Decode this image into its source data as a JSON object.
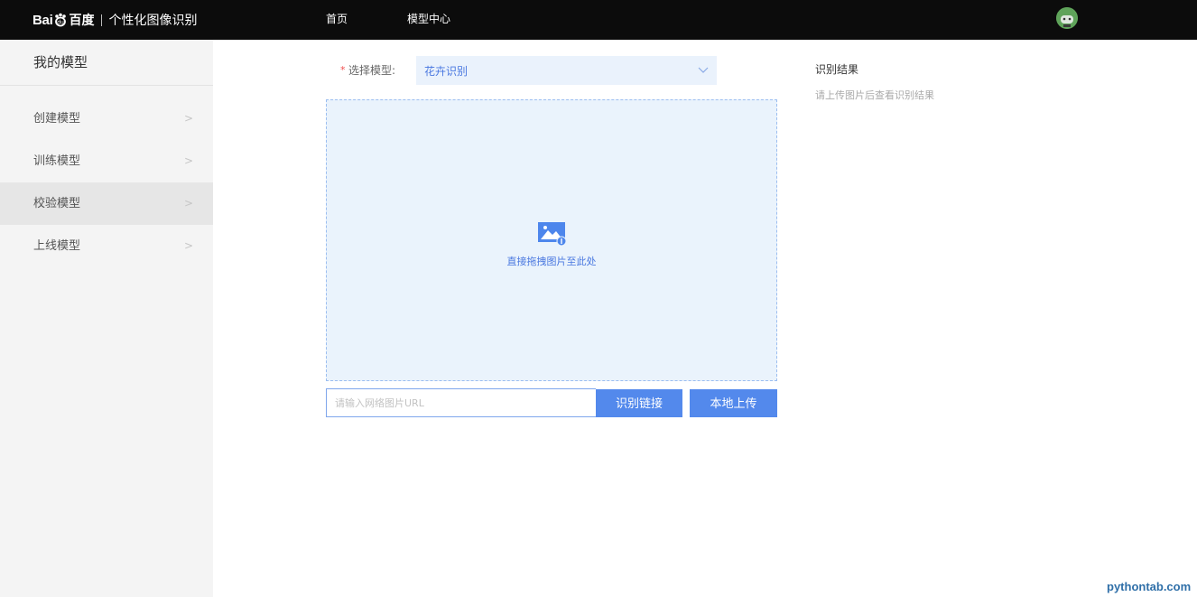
{
  "header": {
    "logo_bai": "Bai",
    "logo_du": "百度",
    "product_name": "个性化图像识别",
    "nav": [
      "首页",
      "模型中心"
    ],
    "avatar_icon": "user-avatar-icon"
  },
  "sidebar": {
    "title": "我的模型",
    "items": [
      {
        "label": "创建模型",
        "active": false
      },
      {
        "label": "训练模型",
        "active": false
      },
      {
        "label": "校验模型",
        "active": true
      },
      {
        "label": "上线模型",
        "active": false
      }
    ],
    "chevron": ">"
  },
  "form": {
    "required_mark": "*",
    "select_label": "选择模型:",
    "select_value": "花卉识别",
    "drop_text": "直接拖拽图片至此处",
    "url_placeholder": "请输入网络图片URL",
    "url_value": "",
    "recognize_url_button": "识别链接",
    "local_upload_button": "本地上传"
  },
  "results": {
    "title": "识别结果",
    "hint": "请上传图片后查看识别结果"
  },
  "watermark": "pythontab.com",
  "colors": {
    "accent": "#5389ec",
    "topbar": "#0c0c0c",
    "dropzone_bg": "#eaf3fc"
  }
}
